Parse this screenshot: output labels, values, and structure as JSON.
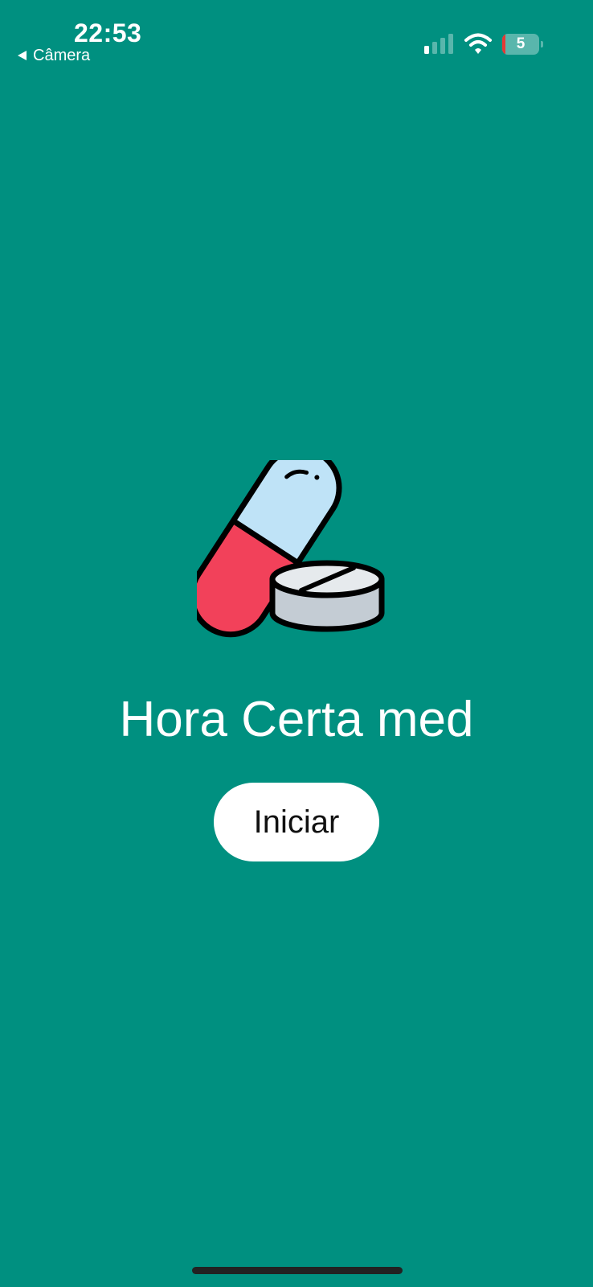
{
  "status_bar": {
    "time": "22:53",
    "back_app_label": "Câmera",
    "battery_level": "5",
    "signal_bars_active": 1,
    "signal_bars_total": 4,
    "icons": [
      "back-caret-icon",
      "cellular-signal-icon",
      "wifi-icon",
      "battery-icon"
    ]
  },
  "main": {
    "logo_icon": "pill-capsule-tablet-icon",
    "title": "Hora Certa med",
    "start_button_label": "Iniciar"
  },
  "colors": {
    "background": "#009080",
    "button_background": "#ffffff",
    "capsule_top": "#bfe3f7",
    "capsule_bottom": "#f2415a",
    "tablet": "#c4ccd4"
  }
}
